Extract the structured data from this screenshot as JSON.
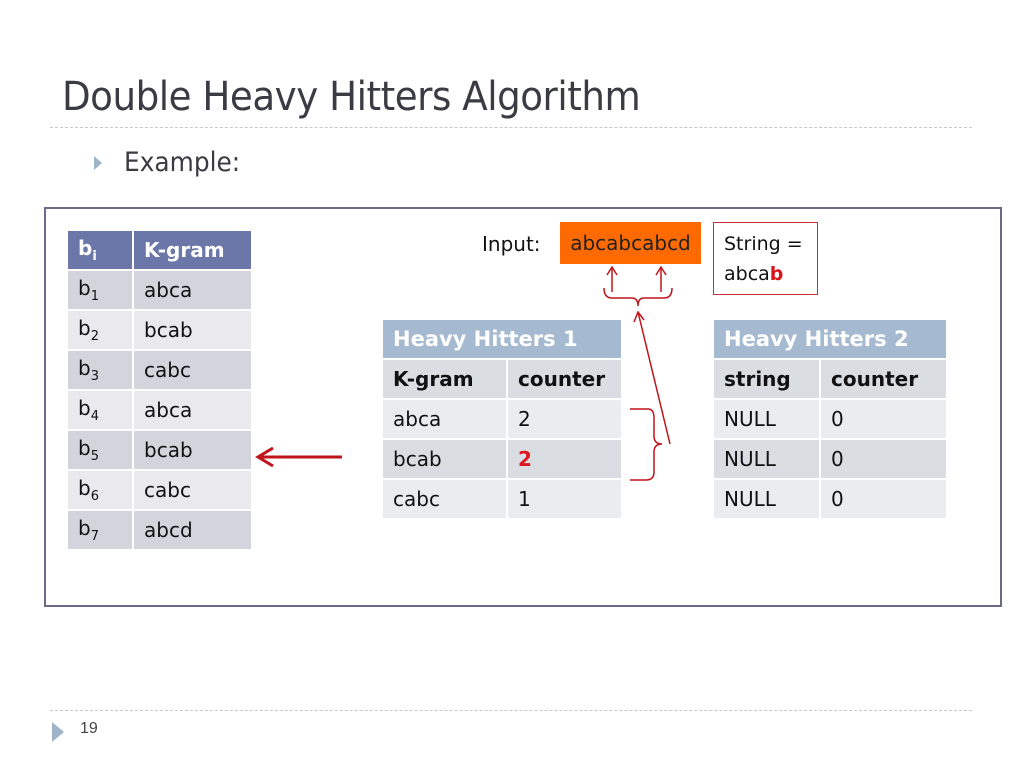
{
  "slide": {
    "title": "Double Heavy Hitters Algorithm",
    "bullet": "Example:",
    "page_number": "19"
  },
  "bi_table": {
    "headers": {
      "index": "b",
      "index_sub": "i",
      "kgram": "K-gram"
    },
    "rows": [
      {
        "b": "b",
        "sub": "1",
        "kgram": "abca"
      },
      {
        "b": "b",
        "sub": "2",
        "kgram": "bcab"
      },
      {
        "b": "b",
        "sub": "3",
        "kgram": "cabc"
      },
      {
        "b": "b",
        "sub": "4",
        "kgram": "abca"
      },
      {
        "b": "b",
        "sub": "5",
        "kgram": "bcab"
      },
      {
        "b": "b",
        "sub": "6",
        "kgram": "cabc"
      },
      {
        "b": "b",
        "sub": "7",
        "kgram": "abcd"
      }
    ],
    "highlighted_row_index": 4
  },
  "input": {
    "label": "Input:",
    "value": "abcabcabcd",
    "box_color": "#ff6a00"
  },
  "string_box": {
    "line1": "String =",
    "prefix": "abca",
    "highlight": "b"
  },
  "heavy_hitters_1": {
    "title": "Heavy Hitters 1",
    "columns": [
      "K-gram",
      "counter"
    ],
    "rows": [
      {
        "key": "abca",
        "counter": "2"
      },
      {
        "key": "bcab",
        "counter": "2"
      },
      {
        "key": "cabc",
        "counter": "1"
      }
    ],
    "highlighted_counter_row": 1
  },
  "heavy_hitters_2": {
    "title": "Heavy Hitters 2",
    "columns": [
      "string",
      "counter"
    ],
    "rows": [
      {
        "key": "NULL",
        "counter": "0"
      },
      {
        "key": "NULL",
        "counter": "0"
      },
      {
        "key": "NULL",
        "counter": "0"
      }
    ]
  },
  "colors": {
    "annotation_red": "#c0141c",
    "highlight_red": "#e0161e",
    "bi_header": "#6b77a8",
    "hh_header": "#a5bad0",
    "frame_border": "#6a6a86"
  }
}
